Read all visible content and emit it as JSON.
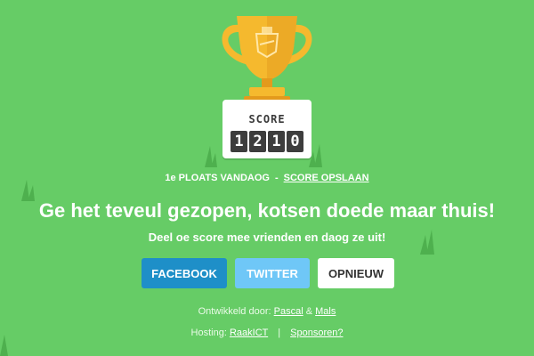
{
  "scoreboard": {
    "label": "SCORE",
    "digits": [
      "1",
      "2",
      "1",
      "0"
    ]
  },
  "rank": {
    "text": "1e PLOATS VANDAOG",
    "separator": "-",
    "save_link": "SCORE OPSLAAN"
  },
  "headline": "Ge het teveul gezopen, kotsen doede maar thuis!",
  "subline": "Deel oe score mee vrienden en daog ze uit!",
  "buttons": {
    "facebook": "FACEBOOK",
    "twitter": "TWITTER",
    "restart": "OPNIEUW"
  },
  "footer": {
    "developed_by": "Ontwikkeld door:",
    "dev1": "Pascal",
    "amp": "&",
    "dev2": "Mals",
    "hosting": "Hosting:",
    "host": "RaakICT",
    "bar": "|",
    "sponsors": "Sponsoren?"
  },
  "colors": {
    "background": "#66cc66",
    "trophy_gold": "#f5b92e",
    "trophy_shade": "#e39a1c",
    "facebook": "#1e8fc8",
    "twitter": "#6fc7f7",
    "grass": "#4eb04e"
  },
  "icons": [
    "trophy-icon",
    "grass-tuft-icon"
  ]
}
